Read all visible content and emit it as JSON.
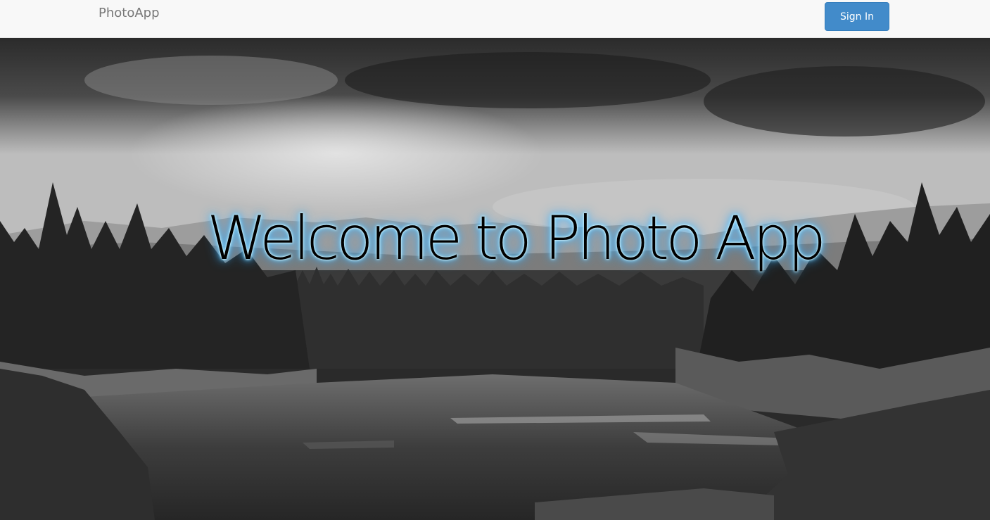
{
  "navbar": {
    "brand": "PhotoApp",
    "signin_label": "Sign In"
  },
  "hero": {
    "headline": "Welcome to Photo App",
    "glow_color": "#3fb4ff"
  },
  "colors": {
    "navbar_bg": "#f8f8f8",
    "brand_text": "#777777",
    "primary_button": "#428bca"
  }
}
